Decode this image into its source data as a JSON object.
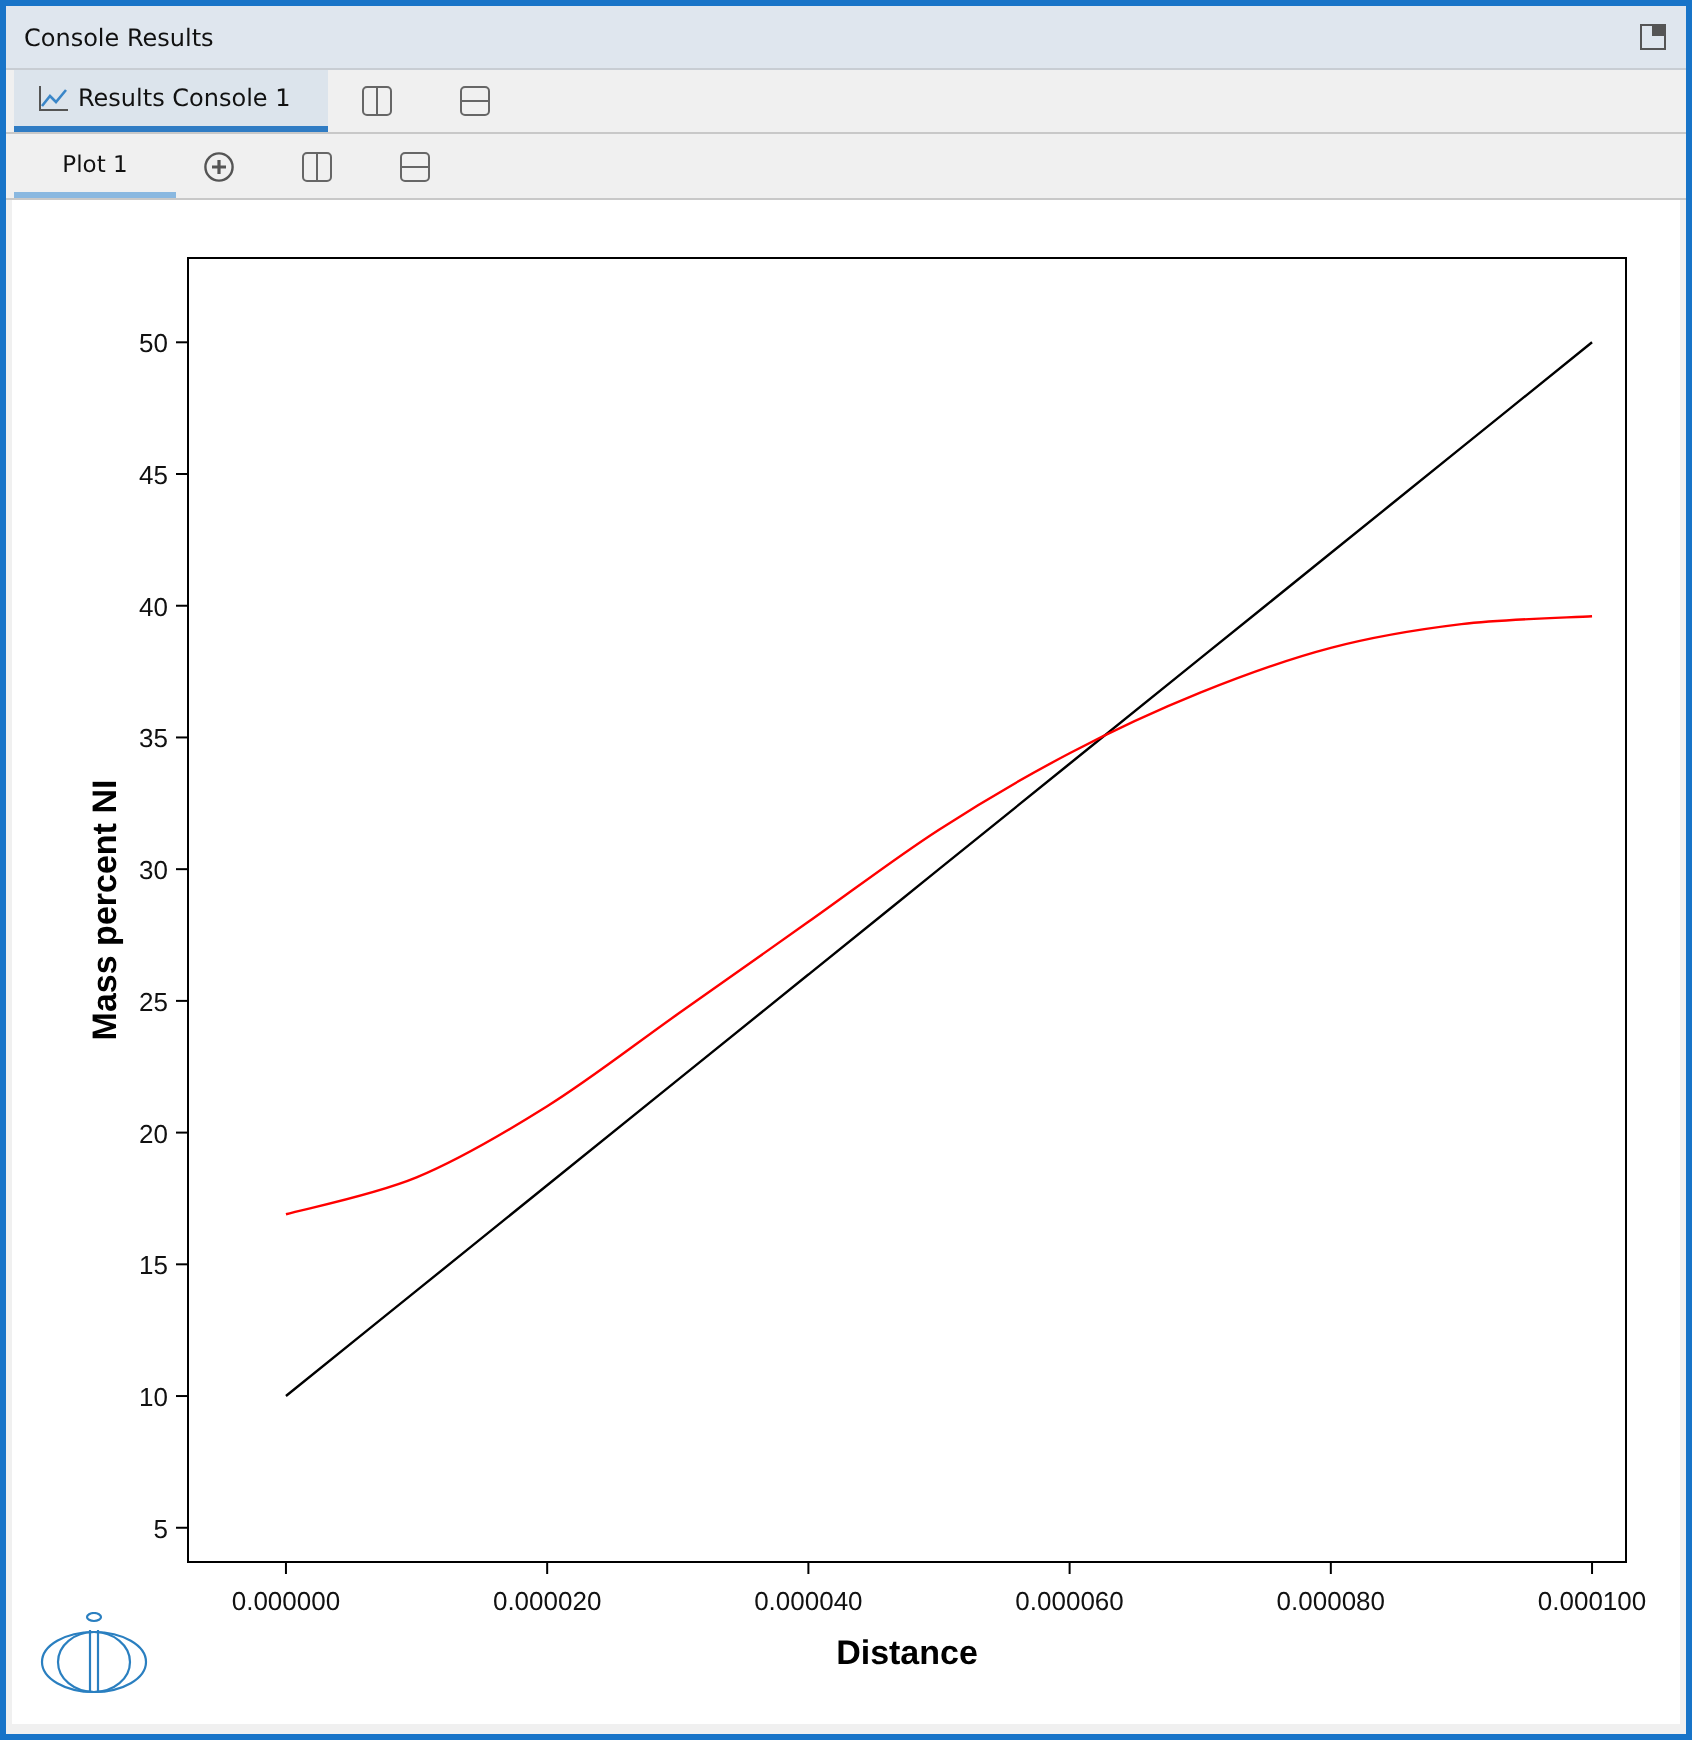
{
  "window": {
    "title": "Console Results"
  },
  "console_tabs": [
    {
      "label": "Results Console 1",
      "selected": true
    }
  ],
  "plot_tabs": [
    {
      "label": "Plot 1",
      "selected": true
    }
  ],
  "plot": {
    "chart_data": {
      "type": "line",
      "xlabel": "Distance",
      "ylabel": "Mass percent NI",
      "x": [
        0,
        1e-05,
        2e-05,
        3e-05,
        4e-05,
        5e-05,
        6e-05,
        7e-05,
        8e-05,
        9e-05,
        0.0001
      ],
      "series": [
        {
          "color": "#000000",
          "values": [
            10,
            14,
            18,
            22,
            26,
            30,
            34,
            38,
            42,
            46,
            50
          ]
        },
        {
          "color": "#ff0000",
          "values": [
            16.9,
            18.3,
            21.0,
            24.5,
            28.0,
            31.5,
            34.4,
            36.7,
            38.4,
            39.3,
            39.6
          ]
        }
      ],
      "xlim": [
        -7.5e-06,
        0.0001026
      ],
      "ylim": [
        3.7,
        53.2
      ],
      "xticks": [
        {
          "value": 0,
          "label": "0.000000"
        },
        {
          "value": 2e-05,
          "label": "0.000020"
        },
        {
          "value": 4e-05,
          "label": "0.000040"
        },
        {
          "value": 6e-05,
          "label": "0.000060"
        },
        {
          "value": 8e-05,
          "label": "0.000080"
        },
        {
          "value": 0.0001,
          "label": "0.000100"
        }
      ],
      "yticks": [
        5,
        10,
        15,
        20,
        25,
        30,
        35,
        40,
        45,
        50
      ]
    }
  }
}
